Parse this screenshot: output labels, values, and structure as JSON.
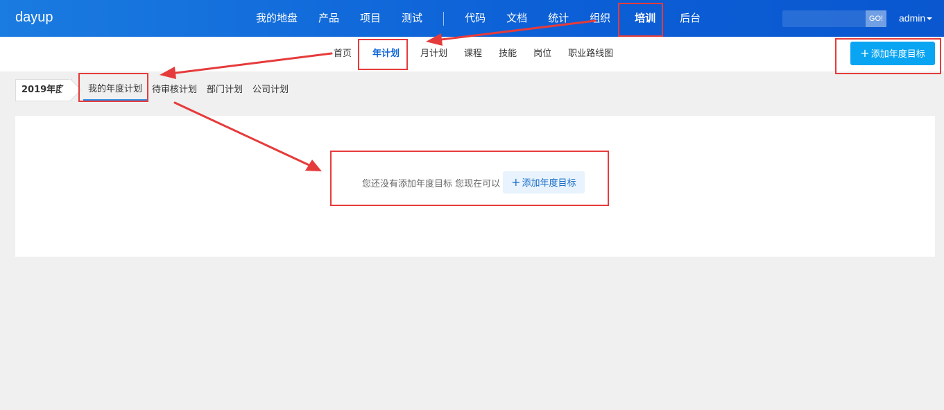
{
  "app": {
    "brand": "dayup"
  },
  "topnav": {
    "items_left": [
      "我的地盘",
      "产品",
      "项目",
      "测试"
    ],
    "items_right": [
      "代码",
      "文档",
      "统计",
      "组织"
    ],
    "active": "培训",
    "items_after": [
      "后台"
    ]
  },
  "search": {
    "value": "",
    "go_label": "GO!"
  },
  "user": {
    "name": "admin"
  },
  "subnav": {
    "items_before": [
      "首页"
    ],
    "active": "年计划",
    "items_after": [
      "月计划",
      "课程",
      "技能",
      "岗位",
      "职业路线图"
    ]
  },
  "header_action": {
    "add_label": "添加年度目标"
  },
  "year_selector": {
    "value": "2019年度"
  },
  "tabs": {
    "active": "我的年度计划",
    "items": [
      "待审核计划",
      "部门计划",
      "公司计划"
    ]
  },
  "empty_state": {
    "message": "您还没有添加年度目标 您现在可以",
    "button_label": "添加年度目标"
  },
  "colors": {
    "navbar": "#0c5fd6",
    "accent": "#0aa5f2",
    "annotation": "#e63b3b"
  }
}
